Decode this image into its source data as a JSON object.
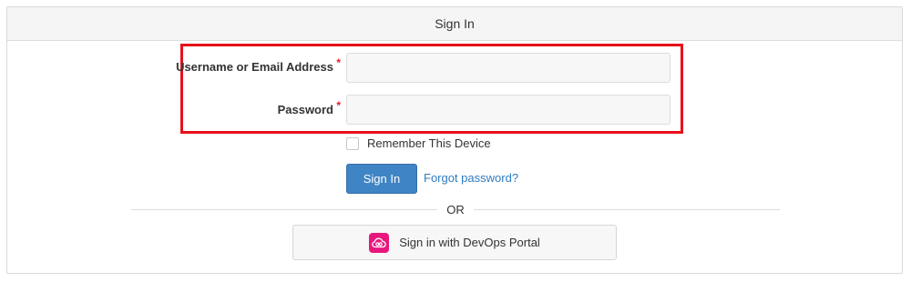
{
  "header": {
    "title": "Sign In"
  },
  "form": {
    "username_label": "Username or Email Address",
    "password_label": "Password",
    "required_marker": "*",
    "username_value": "",
    "password_value": "",
    "remember_label": "Remember This Device",
    "remember_checked": false,
    "signin_label": "Sign In",
    "forgot_label": "Forgot password?"
  },
  "divider": {
    "or_label": "OR"
  },
  "sso": {
    "label": "Sign in with DevOps Portal",
    "icon": "devops-portal-icon"
  },
  "colors": {
    "primary_button": "#3f84c4",
    "link": "#2f7cc2",
    "highlight_border": "#e8101a",
    "required": "#e11d21",
    "sso_icon_bg": "#e8177d"
  }
}
